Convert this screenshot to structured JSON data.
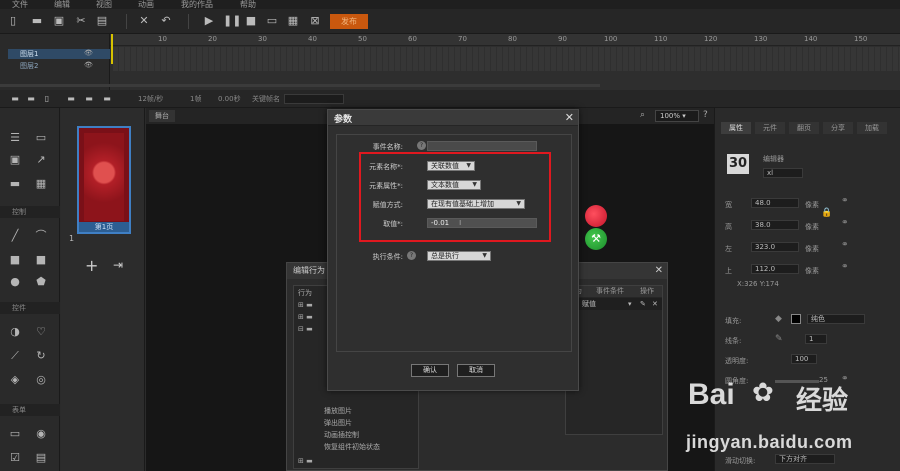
{
  "menubar": {
    "items": [
      "文件",
      "编辑",
      "视图",
      "动画",
      "我的作品",
      "帮助"
    ]
  },
  "toolbar": {
    "publish_label": "发布"
  },
  "timeline": {
    "layers": [
      "图层1",
      "图层2"
    ],
    "ruler_ticks": [
      "10",
      "20",
      "30",
      "40",
      "50",
      "60",
      "70",
      "80",
      "90",
      "100",
      "110",
      "120",
      "130",
      "140",
      "150"
    ]
  },
  "statusbar": {
    "fps": "12帧/秒",
    "frame": "1帧",
    "time": "0.00秒",
    "keyframe_label": "关键帧名"
  },
  "leftbar": {
    "section_control": "控制",
    "section_component": "控件",
    "section_form": "表单"
  },
  "pages": {
    "thumb_label": "第1页",
    "thumb_number": "1"
  },
  "stage": {
    "tab_label": "舞台",
    "zoom": "100%"
  },
  "bg_dialog": {
    "title": "编辑行为",
    "tree_header": "行为",
    "tree_items": [
      "播放图片",
      "弹出图片",
      "动画插控制",
      "恢复组件初始状态"
    ],
    "grid_headers": [
      "行为",
      "事件条件",
      "操作"
    ],
    "grid_row": "赋值"
  },
  "rightpanel": {
    "tabs": [
      "属性",
      "元件",
      "翻页",
      "分享",
      "加载"
    ],
    "font_preview": "30",
    "font_name": "编辑器",
    "font_field": "xl",
    "width_label": "宽",
    "width_value": "48.0",
    "height_label": "高",
    "height_value": "38.0",
    "left_label": "左",
    "left_value": "323.0",
    "top_label": "上",
    "top_value": "112.0",
    "unit": "像素",
    "coords": "X:326   Y:174",
    "fill_label": "填充:",
    "fill_value": "纯色",
    "line_label": "线条:",
    "line_value": "1",
    "opacity_label": "透明度:",
    "opacity_value": "100",
    "round_label": "圆角度:",
    "round_value": "25",
    "anim_label": "滑动切换:",
    "anim_value": "下方对齐"
  },
  "modal": {
    "title": "参数",
    "close": "✕",
    "event_label": "事件名称:",
    "element_label": "元素名称*:",
    "element_value": "关联数值",
    "attr_label": "元素属性*:",
    "attr_value": "文本数值",
    "assign_label": "赋值方式:",
    "assign_value": "在现有值基础上增加",
    "value_label": "取值*:",
    "value_value": "-0.01",
    "cond_label": "执行条件:",
    "cond_value": "总是执行",
    "ok": "确认",
    "cancel": "取消"
  },
  "watermark": {
    "brand": "Bai",
    "brand2": "经验",
    "url": "jingyan.baidu.com"
  },
  "colors": {
    "accent": "#c9580e",
    "highlight": "#e0181f",
    "selection": "#3f7fc4"
  }
}
